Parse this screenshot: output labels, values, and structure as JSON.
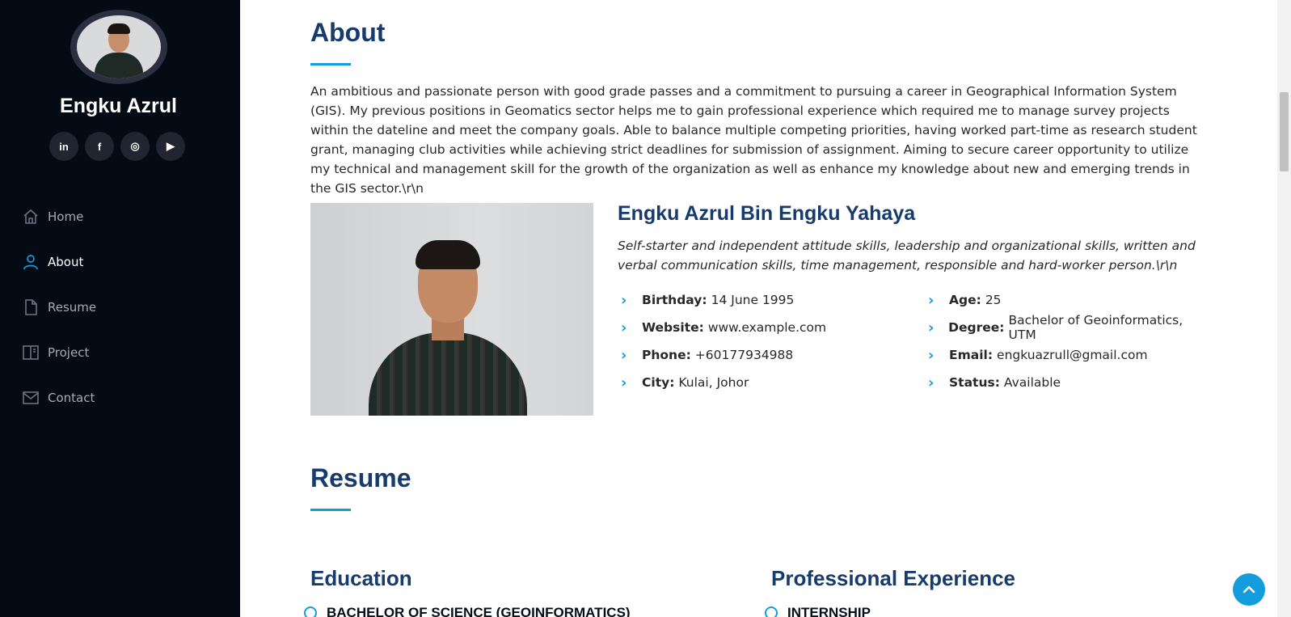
{
  "sidebar": {
    "name": "Engku Azrul",
    "social": [
      {
        "icon": "linkedin-icon",
        "glyph": "in"
      },
      {
        "icon": "facebook-icon",
        "glyph": "f"
      },
      {
        "icon": "instagram-icon",
        "glyph": "◎"
      },
      {
        "icon": "youtube-icon",
        "glyph": "▶"
      }
    ],
    "nav": [
      {
        "label": "Home",
        "icon": "home-icon",
        "active": false
      },
      {
        "label": "About",
        "icon": "user-icon",
        "active": true
      },
      {
        "label": "Resume",
        "icon": "file-icon",
        "active": false
      },
      {
        "label": "Project",
        "icon": "book-icon",
        "active": false
      },
      {
        "label": "Contact",
        "icon": "envelope-icon",
        "active": false
      }
    ]
  },
  "about": {
    "title": "About",
    "text": "An ambitious and passionate person with good grade passes and a commitment to pursuing a career in Geographical Information System (GIS). My previous positions in Geomatics sector helps me to gain professional experience which required me to manage survey projects within the dateline and meet the company goals. Able to balance multiple competing priorities, having worked part-time as research student grant, managing club activities while achieving strict deadlines for submission of assignment. Aiming to secure career opportunity to utilize my technical and management skill for the growth of the organization as well as enhance my knowledge about new and emerging trends in the GIS sector.\\r\\n",
    "profile_name": "Engku Azrul Bin Engku Yahaya",
    "profile_desc": "Self-starter and independent attitude skills, leadership and organizational skills, written and verbal communication skills, time management, responsible and hard-worker person.\\r\\n",
    "info_left": [
      {
        "label": "Birthday:",
        "value": "14 June 1995"
      },
      {
        "label": "Website:",
        "value": "www.example.com"
      },
      {
        "label": "Phone:",
        "value": "+60177934988"
      },
      {
        "label": "City:",
        "value": "Kulai, Johor"
      }
    ],
    "info_right": [
      {
        "label": "Age:",
        "value": "25"
      },
      {
        "label": "Degree:",
        "value": "Bachelor of Geoinformatics, UTM"
      },
      {
        "label": "Email:",
        "value": "engkuazrull@gmail.com"
      },
      {
        "label": "Status:",
        "value": "Available"
      }
    ]
  },
  "resume": {
    "title": "Resume",
    "education_title": "Education",
    "experience_title": "Professional Experience",
    "education_first": "BACHELOR OF SCIENCE (GEOINFORMATICS)",
    "experience_first": "INTERNSHIP"
  },
  "colors": {
    "sidebar_bg": "#040b14",
    "accent": "#149ddd",
    "heading": "#173b6c"
  }
}
